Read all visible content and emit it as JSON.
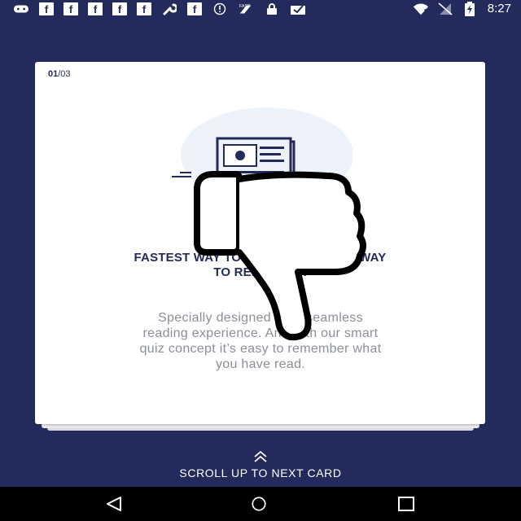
{
  "status_bar": {
    "icons": [
      "gamepad-icon",
      "facebook-icon",
      "facebook-icon",
      "facebook-icon",
      "facebook-icon",
      "facebook-icon",
      "wrench-icon",
      "facebook-icon",
      "alert-icon",
      "fast-charge-icon",
      "lock-icon",
      "inbox-icon"
    ],
    "fb_glyph": "f",
    "time": "8:27"
  },
  "card": {
    "counter_current": "01",
    "counter_total": "/03",
    "title_lines": [
      "FASTEST WAY TO READ. SMARTEST WAY",
      "TO REMEMBER"
    ],
    "body_lines": [
      "Specially designed for a seamless",
      "reading experience. And with our smart",
      "quiz concept it’s easy to remember what",
      "you have read."
    ]
  },
  "overlay": {
    "icon": "thumbs-down-icon"
  },
  "scroll_hint": {
    "label": "SCROLL UP TO NEXT CARD"
  },
  "nav": {
    "back_icon": "back-icon",
    "home_icon": "home-icon",
    "recent_icon": "recent-apps-icon"
  },
  "colors": {
    "background": "#232a5c",
    "title": "#232a5c",
    "body": "#8b8f9a",
    "illustration_bg": "#eef2fb"
  }
}
